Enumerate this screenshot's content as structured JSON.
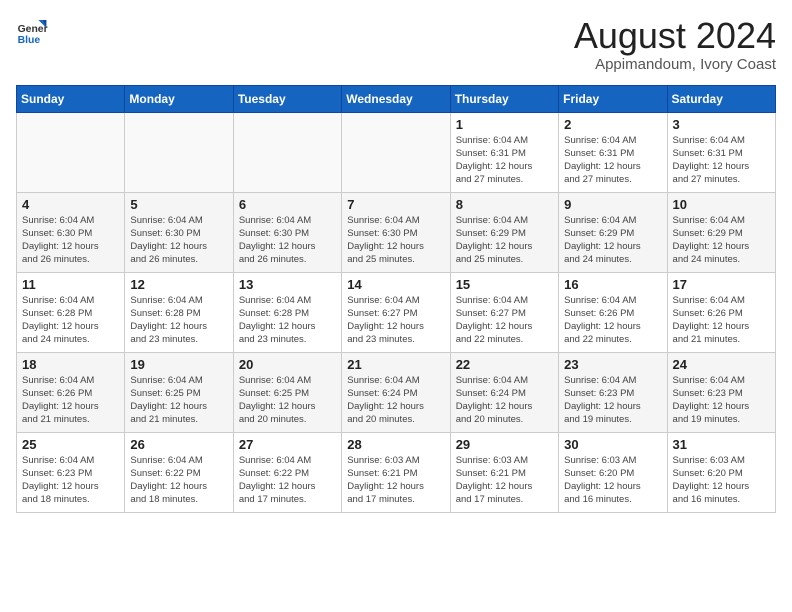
{
  "logo": {
    "line1": "General",
    "line2": "Blue"
  },
  "title": "August 2024",
  "subtitle": "Appimandoum, Ivory Coast",
  "days_of_week": [
    "Sunday",
    "Monday",
    "Tuesday",
    "Wednesday",
    "Thursday",
    "Friday",
    "Saturday"
  ],
  "weeks": [
    [
      {
        "day": "",
        "info": ""
      },
      {
        "day": "",
        "info": ""
      },
      {
        "day": "",
        "info": ""
      },
      {
        "day": "",
        "info": ""
      },
      {
        "day": "1",
        "info": "Sunrise: 6:04 AM\nSunset: 6:31 PM\nDaylight: 12 hours\nand 27 minutes."
      },
      {
        "day": "2",
        "info": "Sunrise: 6:04 AM\nSunset: 6:31 PM\nDaylight: 12 hours\nand 27 minutes."
      },
      {
        "day": "3",
        "info": "Sunrise: 6:04 AM\nSunset: 6:31 PM\nDaylight: 12 hours\nand 27 minutes."
      }
    ],
    [
      {
        "day": "4",
        "info": "Sunrise: 6:04 AM\nSunset: 6:30 PM\nDaylight: 12 hours\nand 26 minutes."
      },
      {
        "day": "5",
        "info": "Sunrise: 6:04 AM\nSunset: 6:30 PM\nDaylight: 12 hours\nand 26 minutes."
      },
      {
        "day": "6",
        "info": "Sunrise: 6:04 AM\nSunset: 6:30 PM\nDaylight: 12 hours\nand 26 minutes."
      },
      {
        "day": "7",
        "info": "Sunrise: 6:04 AM\nSunset: 6:30 PM\nDaylight: 12 hours\nand 25 minutes."
      },
      {
        "day": "8",
        "info": "Sunrise: 6:04 AM\nSunset: 6:29 PM\nDaylight: 12 hours\nand 25 minutes."
      },
      {
        "day": "9",
        "info": "Sunrise: 6:04 AM\nSunset: 6:29 PM\nDaylight: 12 hours\nand 24 minutes."
      },
      {
        "day": "10",
        "info": "Sunrise: 6:04 AM\nSunset: 6:29 PM\nDaylight: 12 hours\nand 24 minutes."
      }
    ],
    [
      {
        "day": "11",
        "info": "Sunrise: 6:04 AM\nSunset: 6:28 PM\nDaylight: 12 hours\nand 24 minutes."
      },
      {
        "day": "12",
        "info": "Sunrise: 6:04 AM\nSunset: 6:28 PM\nDaylight: 12 hours\nand 23 minutes."
      },
      {
        "day": "13",
        "info": "Sunrise: 6:04 AM\nSunset: 6:28 PM\nDaylight: 12 hours\nand 23 minutes."
      },
      {
        "day": "14",
        "info": "Sunrise: 6:04 AM\nSunset: 6:27 PM\nDaylight: 12 hours\nand 23 minutes."
      },
      {
        "day": "15",
        "info": "Sunrise: 6:04 AM\nSunset: 6:27 PM\nDaylight: 12 hours\nand 22 minutes."
      },
      {
        "day": "16",
        "info": "Sunrise: 6:04 AM\nSunset: 6:26 PM\nDaylight: 12 hours\nand 22 minutes."
      },
      {
        "day": "17",
        "info": "Sunrise: 6:04 AM\nSunset: 6:26 PM\nDaylight: 12 hours\nand 21 minutes."
      }
    ],
    [
      {
        "day": "18",
        "info": "Sunrise: 6:04 AM\nSunset: 6:26 PM\nDaylight: 12 hours\nand 21 minutes."
      },
      {
        "day": "19",
        "info": "Sunrise: 6:04 AM\nSunset: 6:25 PM\nDaylight: 12 hours\nand 21 minutes."
      },
      {
        "day": "20",
        "info": "Sunrise: 6:04 AM\nSunset: 6:25 PM\nDaylight: 12 hours\nand 20 minutes."
      },
      {
        "day": "21",
        "info": "Sunrise: 6:04 AM\nSunset: 6:24 PM\nDaylight: 12 hours\nand 20 minutes."
      },
      {
        "day": "22",
        "info": "Sunrise: 6:04 AM\nSunset: 6:24 PM\nDaylight: 12 hours\nand 20 minutes."
      },
      {
        "day": "23",
        "info": "Sunrise: 6:04 AM\nSunset: 6:23 PM\nDaylight: 12 hours\nand 19 minutes."
      },
      {
        "day": "24",
        "info": "Sunrise: 6:04 AM\nSunset: 6:23 PM\nDaylight: 12 hours\nand 19 minutes."
      }
    ],
    [
      {
        "day": "25",
        "info": "Sunrise: 6:04 AM\nSunset: 6:23 PM\nDaylight: 12 hours\nand 18 minutes."
      },
      {
        "day": "26",
        "info": "Sunrise: 6:04 AM\nSunset: 6:22 PM\nDaylight: 12 hours\nand 18 minutes."
      },
      {
        "day": "27",
        "info": "Sunrise: 6:04 AM\nSunset: 6:22 PM\nDaylight: 12 hours\nand 17 minutes."
      },
      {
        "day": "28",
        "info": "Sunrise: 6:03 AM\nSunset: 6:21 PM\nDaylight: 12 hours\nand 17 minutes."
      },
      {
        "day": "29",
        "info": "Sunrise: 6:03 AM\nSunset: 6:21 PM\nDaylight: 12 hours\nand 17 minutes."
      },
      {
        "day": "30",
        "info": "Sunrise: 6:03 AM\nSunset: 6:20 PM\nDaylight: 12 hours\nand 16 minutes."
      },
      {
        "day": "31",
        "info": "Sunrise: 6:03 AM\nSunset: 6:20 PM\nDaylight: 12 hours\nand 16 minutes."
      }
    ]
  ]
}
